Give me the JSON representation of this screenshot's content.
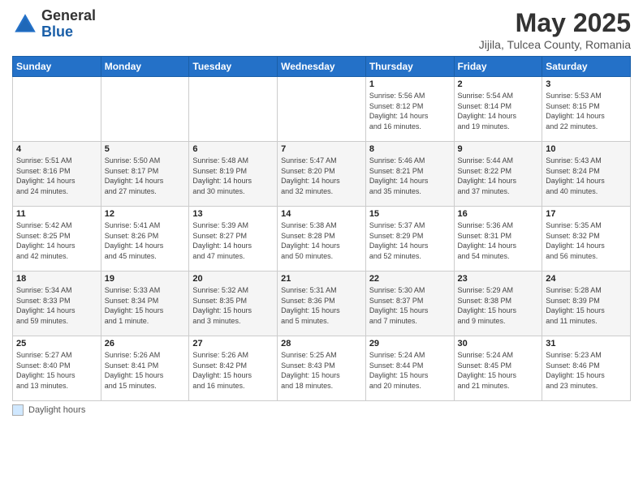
{
  "header": {
    "logo_general": "General",
    "logo_blue": "Blue",
    "month_title": "May 2025",
    "location": "Jijila, Tulcea County, Romania"
  },
  "days_of_week": [
    "Sunday",
    "Monday",
    "Tuesday",
    "Wednesday",
    "Thursday",
    "Friday",
    "Saturday"
  ],
  "footer": {
    "legend_label": "Daylight hours"
  },
  "weeks": [
    [
      {
        "day": "",
        "info": ""
      },
      {
        "day": "",
        "info": ""
      },
      {
        "day": "",
        "info": ""
      },
      {
        "day": "",
        "info": ""
      },
      {
        "day": "1",
        "info": "Sunrise: 5:56 AM\nSunset: 8:12 PM\nDaylight: 14 hours\nand 16 minutes."
      },
      {
        "day": "2",
        "info": "Sunrise: 5:54 AM\nSunset: 8:14 PM\nDaylight: 14 hours\nand 19 minutes."
      },
      {
        "day": "3",
        "info": "Sunrise: 5:53 AM\nSunset: 8:15 PM\nDaylight: 14 hours\nand 22 minutes."
      }
    ],
    [
      {
        "day": "4",
        "info": "Sunrise: 5:51 AM\nSunset: 8:16 PM\nDaylight: 14 hours\nand 24 minutes."
      },
      {
        "day": "5",
        "info": "Sunrise: 5:50 AM\nSunset: 8:17 PM\nDaylight: 14 hours\nand 27 minutes."
      },
      {
        "day": "6",
        "info": "Sunrise: 5:48 AM\nSunset: 8:19 PM\nDaylight: 14 hours\nand 30 minutes."
      },
      {
        "day": "7",
        "info": "Sunrise: 5:47 AM\nSunset: 8:20 PM\nDaylight: 14 hours\nand 32 minutes."
      },
      {
        "day": "8",
        "info": "Sunrise: 5:46 AM\nSunset: 8:21 PM\nDaylight: 14 hours\nand 35 minutes."
      },
      {
        "day": "9",
        "info": "Sunrise: 5:44 AM\nSunset: 8:22 PM\nDaylight: 14 hours\nand 37 minutes."
      },
      {
        "day": "10",
        "info": "Sunrise: 5:43 AM\nSunset: 8:24 PM\nDaylight: 14 hours\nand 40 minutes."
      }
    ],
    [
      {
        "day": "11",
        "info": "Sunrise: 5:42 AM\nSunset: 8:25 PM\nDaylight: 14 hours\nand 42 minutes."
      },
      {
        "day": "12",
        "info": "Sunrise: 5:41 AM\nSunset: 8:26 PM\nDaylight: 14 hours\nand 45 minutes."
      },
      {
        "day": "13",
        "info": "Sunrise: 5:39 AM\nSunset: 8:27 PM\nDaylight: 14 hours\nand 47 minutes."
      },
      {
        "day": "14",
        "info": "Sunrise: 5:38 AM\nSunset: 8:28 PM\nDaylight: 14 hours\nand 50 minutes."
      },
      {
        "day": "15",
        "info": "Sunrise: 5:37 AM\nSunset: 8:29 PM\nDaylight: 14 hours\nand 52 minutes."
      },
      {
        "day": "16",
        "info": "Sunrise: 5:36 AM\nSunset: 8:31 PM\nDaylight: 14 hours\nand 54 minutes."
      },
      {
        "day": "17",
        "info": "Sunrise: 5:35 AM\nSunset: 8:32 PM\nDaylight: 14 hours\nand 56 minutes."
      }
    ],
    [
      {
        "day": "18",
        "info": "Sunrise: 5:34 AM\nSunset: 8:33 PM\nDaylight: 14 hours\nand 59 minutes."
      },
      {
        "day": "19",
        "info": "Sunrise: 5:33 AM\nSunset: 8:34 PM\nDaylight: 15 hours\nand 1 minute."
      },
      {
        "day": "20",
        "info": "Sunrise: 5:32 AM\nSunset: 8:35 PM\nDaylight: 15 hours\nand 3 minutes."
      },
      {
        "day": "21",
        "info": "Sunrise: 5:31 AM\nSunset: 8:36 PM\nDaylight: 15 hours\nand 5 minutes."
      },
      {
        "day": "22",
        "info": "Sunrise: 5:30 AM\nSunset: 8:37 PM\nDaylight: 15 hours\nand 7 minutes."
      },
      {
        "day": "23",
        "info": "Sunrise: 5:29 AM\nSunset: 8:38 PM\nDaylight: 15 hours\nand 9 minutes."
      },
      {
        "day": "24",
        "info": "Sunrise: 5:28 AM\nSunset: 8:39 PM\nDaylight: 15 hours\nand 11 minutes."
      }
    ],
    [
      {
        "day": "25",
        "info": "Sunrise: 5:27 AM\nSunset: 8:40 PM\nDaylight: 15 hours\nand 13 minutes."
      },
      {
        "day": "26",
        "info": "Sunrise: 5:26 AM\nSunset: 8:41 PM\nDaylight: 15 hours\nand 15 minutes."
      },
      {
        "day": "27",
        "info": "Sunrise: 5:26 AM\nSunset: 8:42 PM\nDaylight: 15 hours\nand 16 minutes."
      },
      {
        "day": "28",
        "info": "Sunrise: 5:25 AM\nSunset: 8:43 PM\nDaylight: 15 hours\nand 18 minutes."
      },
      {
        "day": "29",
        "info": "Sunrise: 5:24 AM\nSunset: 8:44 PM\nDaylight: 15 hours\nand 20 minutes."
      },
      {
        "day": "30",
        "info": "Sunrise: 5:24 AM\nSunset: 8:45 PM\nDaylight: 15 hours\nand 21 minutes."
      },
      {
        "day": "31",
        "info": "Sunrise: 5:23 AM\nSunset: 8:46 PM\nDaylight: 15 hours\nand 23 minutes."
      }
    ]
  ]
}
